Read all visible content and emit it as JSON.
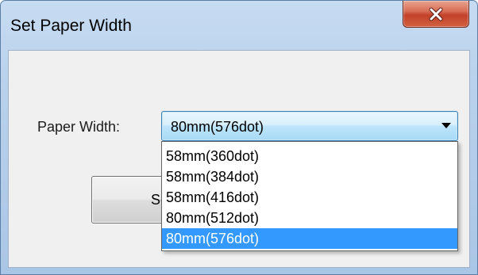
{
  "window": {
    "title": "Set Paper Width"
  },
  "form": {
    "paper_width_label": "Paper Width:",
    "selected_value": "80mm(576dot)",
    "set_button_label": "Set",
    "options": [
      "58mm(360dot)",
      "58mm(384dot)",
      "58mm(416dot)",
      "80mm(512dot)",
      "80mm(576dot)"
    ],
    "highlighted_option_index": 4
  },
  "icons": {
    "close": "close-icon",
    "dropdown": "chevron-down-icon"
  },
  "colors": {
    "close_button": "#c2412a",
    "selection_highlight": "#3399ff",
    "dropdown_border": "#3c7fb1"
  }
}
